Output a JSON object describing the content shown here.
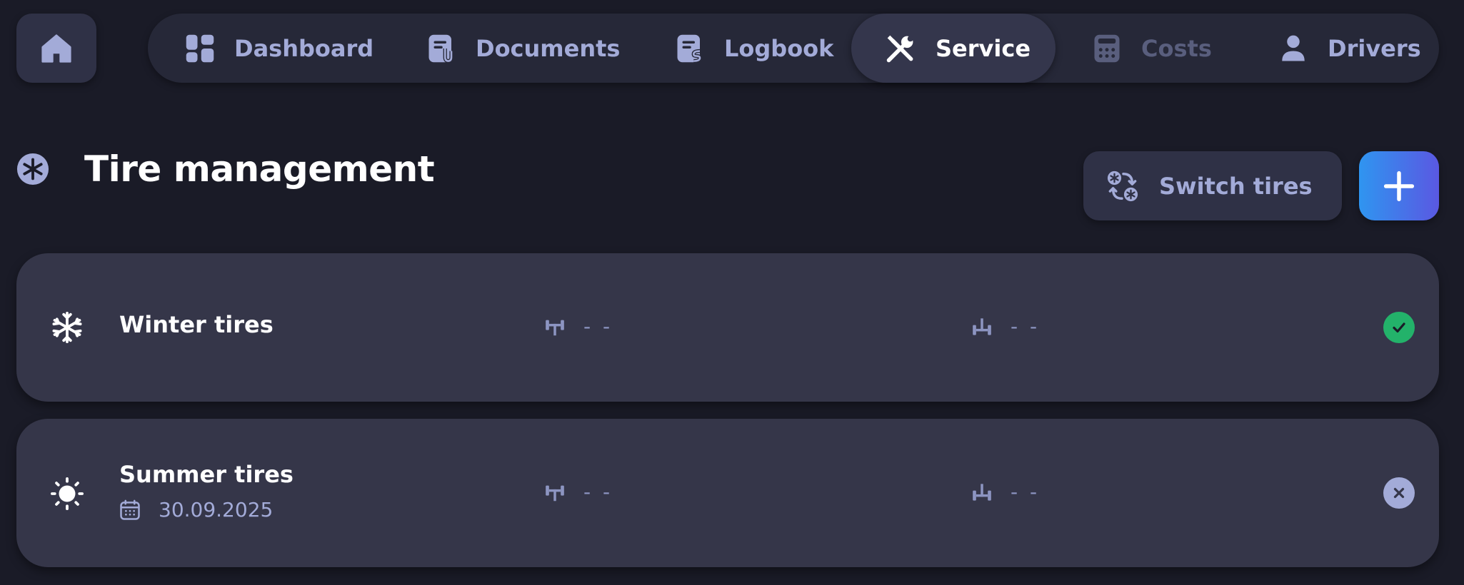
{
  "nav": {
    "items": [
      {
        "label": "Dashboard",
        "icon": "dashboard-icon",
        "state": "normal"
      },
      {
        "label": "Documents",
        "icon": "document-attachment-icon",
        "state": "normal"
      },
      {
        "label": "Logbook",
        "icon": "logbook-icon",
        "state": "normal"
      },
      {
        "label": "Service",
        "icon": "tools-icon",
        "state": "active"
      },
      {
        "label": "Costs",
        "icon": "calculator-icon",
        "state": "disabled"
      },
      {
        "label": "Drivers",
        "icon": "user-icon",
        "state": "normal"
      }
    ]
  },
  "page": {
    "title": "Tire management",
    "switch_button": "Switch tires"
  },
  "tires": [
    {
      "name": "Winter tires",
      "icon": "snowflake-icon",
      "date": "",
      "front_axle": "- -",
      "rear_axle": "- -",
      "status": "mounted"
    },
    {
      "name": "Summer tires",
      "icon": "sun-icon",
      "date": "30.09.2025",
      "front_axle": "- -",
      "rear_axle": "- -",
      "status": "not-mounted"
    }
  ],
  "colors": {
    "background": "#1a1b27",
    "surface": "#353649",
    "text_muted": "#a3abd8",
    "accent_start": "#2f95f0",
    "accent_end": "#5a58e2",
    "success": "#23b26a"
  }
}
